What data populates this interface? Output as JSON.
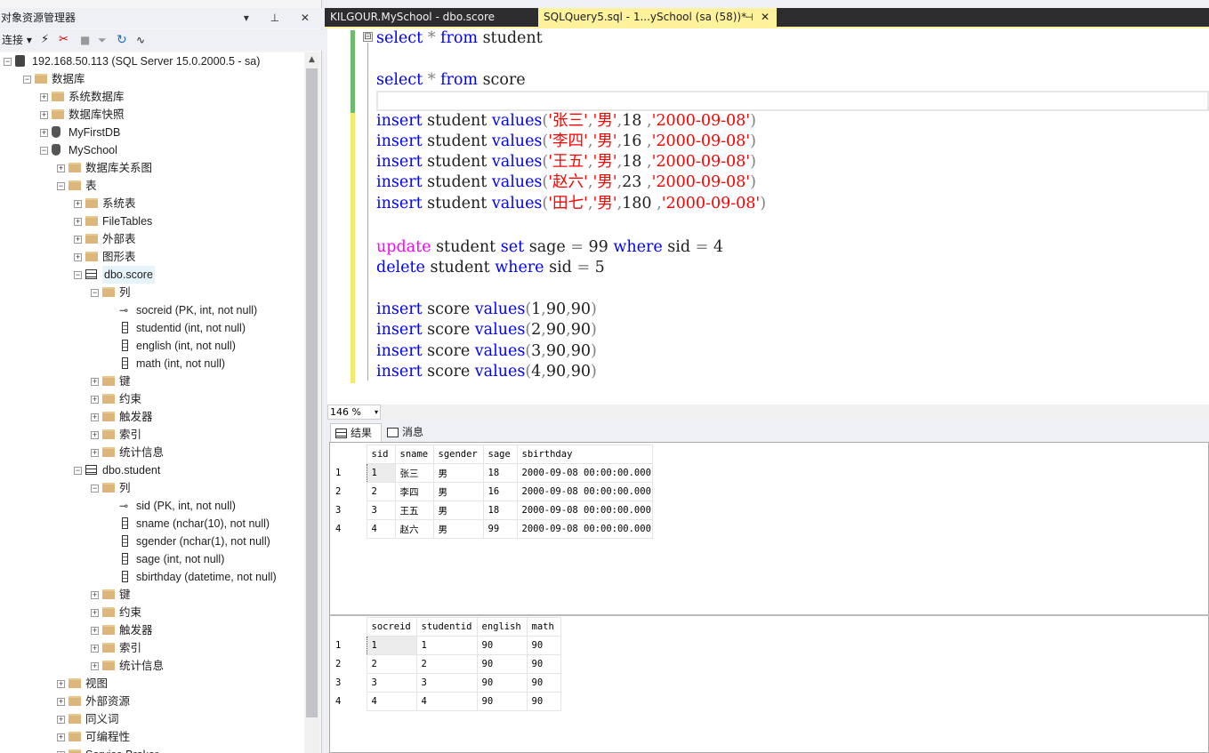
{
  "object_explorer": {
    "title": "对象资源管理器",
    "title_buttons": "▾ ⊥ ✕",
    "toolbar": {
      "connect": "连接 ▾"
    },
    "tree": [
      {
        "label": "192.168.50.113 (SQL Server 15.0.2000.5 - sa)",
        "icon": "server-icon",
        "exp": "⊟"
      },
      {
        "label": "数据库",
        "icon": "folder-icon",
        "exp": "⊟"
      },
      {
        "label": "系统数据库",
        "icon": "folder-icon",
        "exp": "⊞"
      },
      {
        "label": "数据库快照",
        "icon": "folder-icon",
        "exp": "⊞"
      },
      {
        "label": "MyFirstDB",
        "icon": "database-icon",
        "exp": "⊞"
      },
      {
        "label": "MySchool",
        "icon": "database-icon",
        "exp": "⊟"
      },
      {
        "label": "数据库关系图",
        "icon": "folder-icon",
        "exp": "⊞"
      },
      {
        "label": "表",
        "icon": "folder-icon",
        "exp": "⊟"
      },
      {
        "label": "系统表",
        "icon": "folder-icon",
        "exp": "⊞"
      },
      {
        "label": "FileTables",
        "icon": "folder-icon",
        "exp": "⊞"
      },
      {
        "label": "外部表",
        "icon": "folder-icon",
        "exp": "⊞"
      },
      {
        "label": "图形表",
        "icon": "folder-icon",
        "exp": "⊞"
      },
      {
        "label": "dbo.score",
        "icon": "table-icon",
        "exp": "⊟"
      },
      {
        "label": "列",
        "icon": "folder-icon",
        "exp": "⊟"
      },
      {
        "label": "socreid (PK, int, not null)",
        "icon": "key-icon",
        "exp": ""
      },
      {
        "label": "studentid (int, not null)",
        "icon": "column-icon",
        "exp": ""
      },
      {
        "label": "english (int, not null)",
        "icon": "column-icon",
        "exp": ""
      },
      {
        "label": "math (int, not null)",
        "icon": "column-icon",
        "exp": ""
      },
      {
        "label": "键",
        "icon": "folder-icon",
        "exp": "⊞"
      },
      {
        "label": "约束",
        "icon": "folder-icon",
        "exp": "⊞"
      },
      {
        "label": "触发器",
        "icon": "folder-icon",
        "exp": "⊞"
      },
      {
        "label": "索引",
        "icon": "folder-icon",
        "exp": "⊞"
      },
      {
        "label": "统计信息",
        "icon": "folder-icon",
        "exp": "⊞"
      },
      {
        "label": "dbo.student",
        "icon": "table-icon",
        "exp": "⊟"
      },
      {
        "label": "列",
        "icon": "folder-icon",
        "exp": "⊟"
      },
      {
        "label": "sid (PK, int, not null)",
        "icon": "key-icon",
        "exp": ""
      },
      {
        "label": "sname (nchar(10), not null)",
        "icon": "column-icon",
        "exp": ""
      },
      {
        "label": "sgender (nchar(1), not null)",
        "icon": "column-icon",
        "exp": ""
      },
      {
        "label": "sage (int, not null)",
        "icon": "column-icon",
        "exp": ""
      },
      {
        "label": "sbirthday (datetime, not null)",
        "icon": "column-icon",
        "exp": ""
      },
      {
        "label": "键",
        "icon": "folder-icon",
        "exp": "⊞"
      },
      {
        "label": "约束",
        "icon": "folder-icon",
        "exp": "⊞"
      },
      {
        "label": "触发器",
        "icon": "folder-icon",
        "exp": "⊞"
      },
      {
        "label": "索引",
        "icon": "folder-icon",
        "exp": "⊞"
      },
      {
        "label": "统计信息",
        "icon": "folder-icon",
        "exp": "⊞"
      },
      {
        "label": "视图",
        "icon": "folder-icon",
        "exp": "⊞"
      },
      {
        "label": "外部资源",
        "icon": "folder-icon",
        "exp": "⊞"
      },
      {
        "label": "同义词",
        "icon": "folder-icon",
        "exp": "⊞"
      },
      {
        "label": "可编程性",
        "icon": "folder-icon",
        "exp": "⊞"
      },
      {
        "label": "Service Broker",
        "icon": "folder-icon",
        "exp": "⊞"
      }
    ],
    "selected_index": 12
  },
  "tabs": [
    {
      "label": "KILGOUR.MySchool - dbo.score"
    },
    {
      "label": "SQLQuery5.sql - 1...ySchool (sa (58))*",
      "pin": "⊣",
      "close": "✕"
    }
  ],
  "editor": {
    "fold_marker": "⊟",
    "lines": [
      [
        [
          "kw",
          "select"
        ],
        [
          "op",
          " * "
        ],
        [
          "kw",
          "from"
        ],
        [
          "t",
          " student"
        ]
      ],
      [],
      [
        [
          "kw",
          "select"
        ],
        [
          "op",
          " * "
        ],
        [
          "kw",
          "from"
        ],
        [
          "t",
          " score"
        ]
      ],
      [],
      [
        [
          "kw",
          "insert"
        ],
        [
          "t",
          " student "
        ],
        [
          "kw",
          "values"
        ],
        [
          "op",
          "("
        ],
        [
          "str",
          "'张三'"
        ],
        [
          "op",
          ","
        ],
        [
          "str",
          "'男'"
        ],
        [
          "op",
          ","
        ],
        [
          "t",
          "18 "
        ],
        [
          "op",
          ","
        ],
        [
          "str",
          "'2000-09-08'"
        ],
        [
          "op",
          ")"
        ]
      ],
      [
        [
          "kw",
          "insert"
        ],
        [
          "t",
          " student "
        ],
        [
          "kw",
          "values"
        ],
        [
          "op",
          "("
        ],
        [
          "str",
          "'李四'"
        ],
        [
          "op",
          ","
        ],
        [
          "str",
          "'男'"
        ],
        [
          "op",
          ","
        ],
        [
          "t",
          "16 "
        ],
        [
          "op",
          ","
        ],
        [
          "str",
          "'2000-09-08'"
        ],
        [
          "op",
          ")"
        ]
      ],
      [
        [
          "kw",
          "insert"
        ],
        [
          "t",
          " student "
        ],
        [
          "kw",
          "values"
        ],
        [
          "op",
          "("
        ],
        [
          "str",
          "'王五'"
        ],
        [
          "op",
          ","
        ],
        [
          "str",
          "'男'"
        ],
        [
          "op",
          ","
        ],
        [
          "t",
          "18 "
        ],
        [
          "op",
          ","
        ],
        [
          "str",
          "'2000-09-08'"
        ],
        [
          "op",
          ")"
        ]
      ],
      [
        [
          "kw",
          "insert"
        ],
        [
          "t",
          " student "
        ],
        [
          "kw",
          "values"
        ],
        [
          "op",
          "("
        ],
        [
          "str",
          "'赵六'"
        ],
        [
          "op",
          ","
        ],
        [
          "str",
          "'男'"
        ],
        [
          "op",
          ","
        ],
        [
          "t",
          "23 "
        ],
        [
          "op",
          ","
        ],
        [
          "str",
          "'2000-09-08'"
        ],
        [
          "op",
          ")"
        ]
      ],
      [
        [
          "kw",
          "insert"
        ],
        [
          "t",
          " student "
        ],
        [
          "kw",
          "values"
        ],
        [
          "op",
          "("
        ],
        [
          "str",
          "'田七'"
        ],
        [
          "op",
          ","
        ],
        [
          "str",
          "'男'"
        ],
        [
          "op",
          ","
        ],
        [
          "t",
          "180 "
        ],
        [
          "op",
          ","
        ],
        [
          "str",
          "'2000-09-08'"
        ],
        [
          "op",
          ")"
        ]
      ],
      [],
      [
        [
          "fn",
          "update"
        ],
        [
          "t",
          " student "
        ],
        [
          "kw",
          "set"
        ],
        [
          "t",
          " sage "
        ],
        [
          "op",
          "="
        ],
        [
          "t",
          " 99 "
        ],
        [
          "kw",
          "where"
        ],
        [
          "t",
          " sid "
        ],
        [
          "op",
          "="
        ],
        [
          "t",
          " 4"
        ]
      ],
      [
        [
          "kw",
          "delete"
        ],
        [
          "t",
          " student "
        ],
        [
          "kw",
          "where"
        ],
        [
          "t",
          " sid "
        ],
        [
          "op",
          "="
        ],
        [
          "t",
          " 5"
        ]
      ],
      [],
      [
        [
          "kw",
          "insert"
        ],
        [
          "t",
          " score "
        ],
        [
          "kw",
          "values"
        ],
        [
          "op",
          "("
        ],
        [
          "t",
          "1"
        ],
        [
          "op",
          ","
        ],
        [
          "t",
          "90"
        ],
        [
          "op",
          ","
        ],
        [
          "t",
          "90"
        ],
        [
          "op",
          ")"
        ]
      ],
      [
        [
          "kw",
          "insert"
        ],
        [
          "t",
          " score "
        ],
        [
          "kw",
          "values"
        ],
        [
          "op",
          "("
        ],
        [
          "t",
          "2"
        ],
        [
          "op",
          ","
        ],
        [
          "t",
          "90"
        ],
        [
          "op",
          ","
        ],
        [
          "t",
          "90"
        ],
        [
          "op",
          ")"
        ]
      ],
      [
        [
          "kw",
          "insert"
        ],
        [
          "t",
          " score "
        ],
        [
          "kw",
          "values"
        ],
        [
          "op",
          "("
        ],
        [
          "t",
          "3"
        ],
        [
          "op",
          ","
        ],
        [
          "t",
          "90"
        ],
        [
          "op",
          ","
        ],
        [
          "t",
          "90"
        ],
        [
          "op",
          ")"
        ]
      ],
      [
        [
          "kw",
          "insert"
        ],
        [
          "t",
          " score "
        ],
        [
          "kw",
          "values"
        ],
        [
          "op",
          "("
        ],
        [
          "t",
          "4"
        ],
        [
          "op",
          ","
        ],
        [
          "t",
          "90"
        ],
        [
          "op",
          ","
        ],
        [
          "t",
          "90"
        ],
        [
          "op",
          ")"
        ]
      ]
    ],
    "margin_colors": [
      "#6dbb6d",
      "#6dbb6d",
      "#6dbb6d",
      "#6dbb6d",
      "#f4e96b",
      "#f4e96b",
      "#f4e96b",
      "#f4e96b",
      "#f4e96b",
      "#f4e96b",
      "#f4e96b",
      "#f4e96b",
      "#f4e96b",
      "#f4e96b",
      "#f4e96b",
      "#f4e96b",
      "#f4e96b"
    ]
  },
  "zoom": {
    "value": "146 %",
    "dropdown": "▾"
  },
  "result_tabs": {
    "results": "结果",
    "messages": "消息"
  },
  "grid1": {
    "columns": [
      "sid",
      "sname",
      "sgender",
      "sage",
      "sbirthday"
    ],
    "rows": [
      [
        "1",
        "1",
        "张三",
        "男",
        "18",
        "2000-09-08 00:00:00.000"
      ],
      [
        "2",
        "2",
        "李四",
        "男",
        "16",
        "2000-09-08 00:00:00.000"
      ],
      [
        "3",
        "3",
        "王五",
        "男",
        "18",
        "2000-09-08 00:00:00.000"
      ],
      [
        "4",
        "4",
        "赵六",
        "男",
        "99",
        "2000-09-08 00:00:00.000"
      ]
    ]
  },
  "grid2": {
    "columns": [
      "socreid",
      "studentid",
      "english",
      "math"
    ],
    "rows": [
      [
        "1",
        "1",
        "1",
        "90",
        "90"
      ],
      [
        "2",
        "2",
        "2",
        "90",
        "90"
      ],
      [
        "3",
        "3",
        "3",
        "90",
        "90"
      ],
      [
        "4",
        "4",
        "4",
        "90",
        "90"
      ]
    ]
  }
}
